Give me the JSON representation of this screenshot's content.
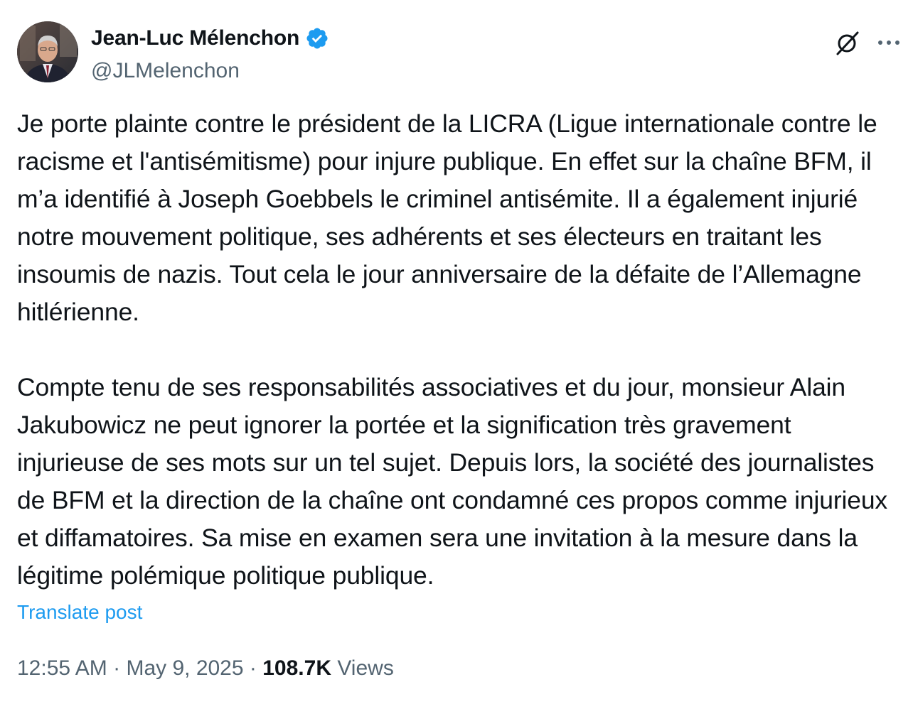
{
  "author": {
    "display_name": "Jean-Luc Mélenchon",
    "handle": "@JLMelenchon",
    "verified_icon": "verified-badge-icon",
    "verified_color": "#1d9bf0"
  },
  "actions": {
    "grok_icon": "grok-icon",
    "more_icon": "more-horizontal-icon"
  },
  "tweet": {
    "paragraphs": [
      "Je porte plainte contre le président de la LICRA (Ligue internationale contre le racisme et l'antisémitisme) pour injure publique. En effet sur la chaîne BFM, il m’a identifié à Joseph Goebbels le criminel antisémite. Il a également injurié notre mouvement politique, ses adhérents et ses électeurs en traitant les insoumis de nazis. Tout cela le jour anniversaire de la défaite de l’Allemagne hitlérienne.",
      "Compte tenu de ses responsabilités associatives et du jour, monsieur Alain Jakubowicz ne peut ignorer la portée et la signification très gravement injurieuse de ses mots sur un tel sujet. Depuis lors, la société des journalistes de BFM et la direction de la chaîne ont condamné ces propos comme injurieux et diffamatoires. Sa mise en examen sera une invitation à la mesure dans la légitime polémique politique publique."
    ],
    "translate_label": "Translate post",
    "time": "12:55 AM",
    "separator": "·",
    "date": "May 9, 2025",
    "views_count": "108.7K",
    "views_label": "Views"
  },
  "colors": {
    "text": "#0f1419",
    "secondary": "#536471",
    "link": "#1d9bf0"
  }
}
